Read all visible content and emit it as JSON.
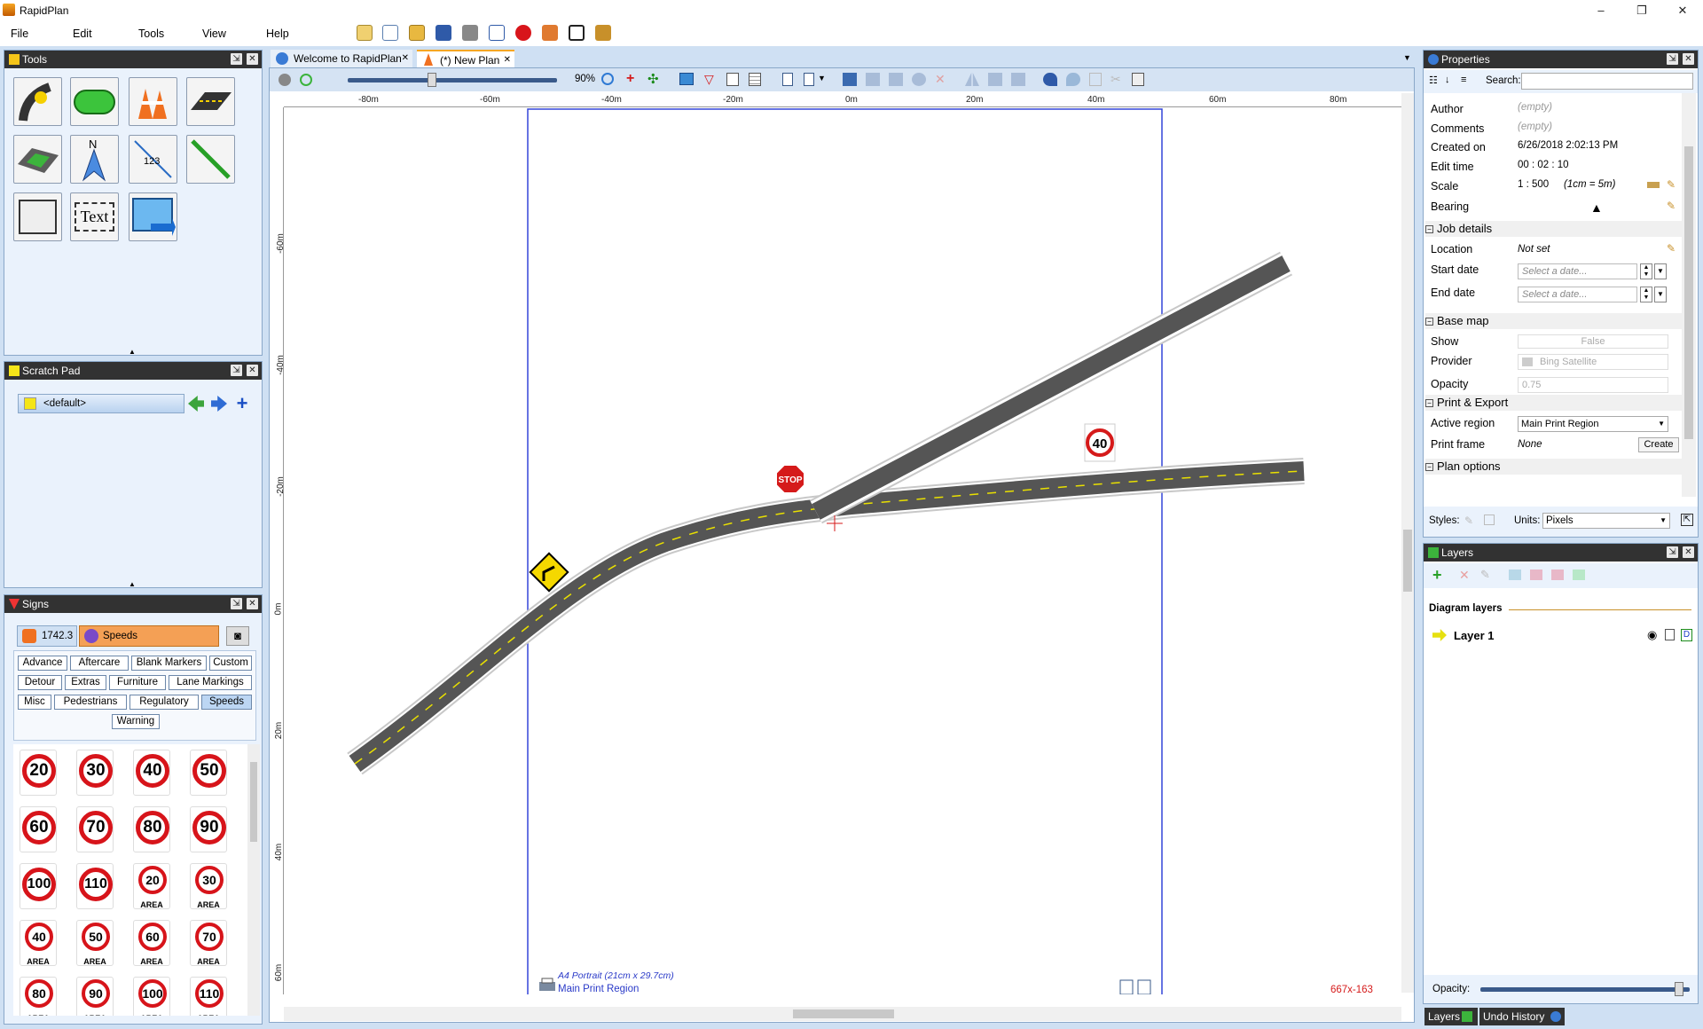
{
  "app": {
    "title": "RapidPlan"
  },
  "window_controls": {
    "minimize": "–",
    "restore": "❐",
    "close": "✕"
  },
  "menu": [
    "File",
    "Edit",
    "Tools",
    "View",
    "Help"
  ],
  "tabs": [
    {
      "label": "Welcome to RapidPlan",
      "close": "✕"
    },
    {
      "label": "(*) New Plan",
      "close": "✕"
    }
  ],
  "panels": {
    "tools": {
      "title": "Tools",
      "text_tool_label": "Text"
    },
    "scratch_pad": {
      "title": "Scratch Pad",
      "selected": "<default>"
    },
    "signs": {
      "title": "Signs",
      "count": "1742.3",
      "group": "Speeds",
      "categories": [
        "Advance",
        "Aftercare",
        "Blank Markers",
        "Custom",
        "Detour",
        "Extras",
        "Furniture",
        "Lane Markings",
        "Misc",
        "Pedestrians",
        "Regulatory",
        "Speeds",
        "Warning"
      ],
      "selected_category": "Speeds",
      "area_label": "AREA",
      "items": [
        "20",
        "30",
        "40",
        "50",
        "60",
        "70",
        "80",
        "90",
        "100",
        "110",
        "20",
        "30",
        "40",
        "50",
        "60",
        "70",
        "80",
        "90",
        "100",
        "110"
      ]
    },
    "properties": {
      "title": "Properties",
      "search_label": "Search:",
      "rows": {
        "author": {
          "label": "Author",
          "value": "(empty)"
        },
        "comments": {
          "label": "Comments",
          "value": "(empty)"
        },
        "created_on": {
          "label": "Created on",
          "value": "6/26/2018 2:02:13 PM"
        },
        "edit_time": {
          "label": "Edit time",
          "value": "00 : 02 : 10"
        },
        "scale": {
          "label": "Scale",
          "value": "1 : 500",
          "note": "(1cm = 5m)"
        },
        "bearing": {
          "label": "Bearing"
        }
      },
      "job_details": {
        "title": "Job details",
        "location_label": "Location",
        "location_value": "Not set",
        "start_label": "Start date",
        "end_label": "End date",
        "date_placeholder": "Select a date..."
      },
      "base_map": {
        "title": "Base map",
        "show_label": "Show",
        "show_value": "False",
        "provider_label": "Provider",
        "provider_value": "Bing Satellite",
        "opacity_label": "Opacity",
        "opacity_value": "0.75"
      },
      "print_export": {
        "title": "Print & Export",
        "active_label": "Active region",
        "active_value": "Main Print Region",
        "frame_label": "Print frame",
        "frame_value": "None",
        "create_label": "Create"
      },
      "plan_options": {
        "title": "Plan options"
      },
      "styles_label": "Styles:",
      "units_label": "Units:",
      "units_value": "Pixels"
    },
    "layers": {
      "title": "Layers",
      "section": "Diagram layers",
      "layer1": "Layer 1",
      "opacity_label": "Opacity:",
      "opacity": 0.97
    }
  },
  "bottom_tabs": [
    "Layers",
    "Undo History"
  ],
  "canvas": {
    "zoom": "90%",
    "zoom_level": 0.4,
    "ruler_h": [
      "-80m",
      "-60m",
      "-40m",
      "-20m",
      "0m",
      "20m",
      "40m",
      "60m",
      "80m"
    ],
    "ruler_v": [
      "-60m",
      "-40m",
      "-20m",
      "0m",
      "20m",
      "40m",
      "60m"
    ],
    "page_size": "A4 Portrait (21cm x 29.7cm)",
    "page_region": "Main Print Region",
    "coordinates": "667x-163",
    "stop_label": "STOP",
    "speed_sign": "40"
  }
}
